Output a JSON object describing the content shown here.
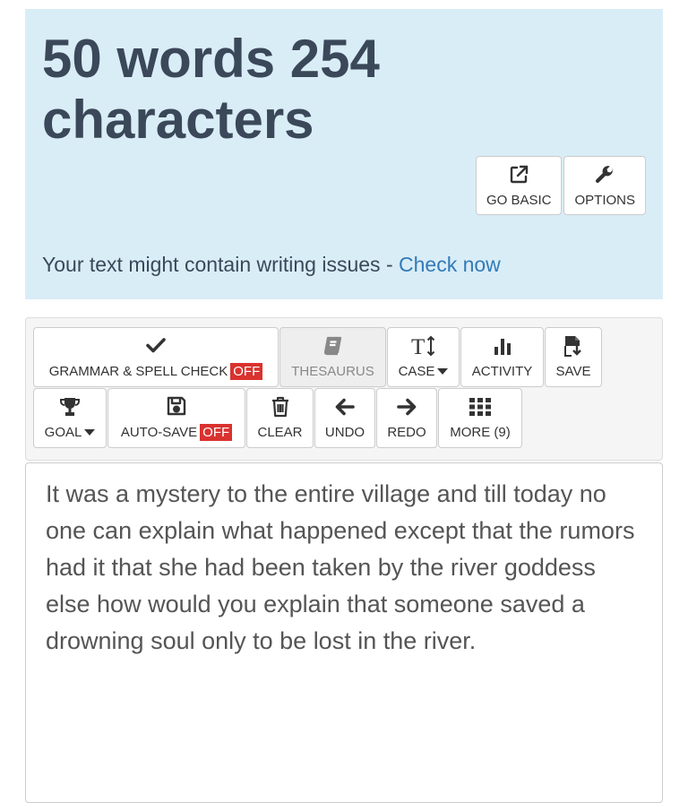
{
  "stats": {
    "title": "50 words 254 characters"
  },
  "top_buttons": {
    "go_basic": "GO BASIC",
    "options": "OPTIONS"
  },
  "issues": {
    "text": "Your text might contain writing issues - ",
    "link": "Check now"
  },
  "toolbar": {
    "grammar": "GRAMMAR & SPELL CHECK",
    "grammar_state": "OFF",
    "thesaurus": "THESAURUS",
    "case": "CASE",
    "activity": "ACTIVITY",
    "save": "SAVE",
    "goal": "GOAL",
    "autosave": "AUTO-SAVE",
    "autosave_state": "OFF",
    "clear": "CLEAR",
    "undo": "UNDO",
    "redo": "REDO",
    "more": "MORE (9)"
  },
  "editor": {
    "text": "It was a mystery to the entire village and till today no one can explain what happened except that the rumors had it that she had been taken by the river goddess else how would you explain that someone saved a drowning soul only to be lost in the river."
  },
  "colors": {
    "panel_bg": "#d9edf7",
    "title": "#3b4859",
    "link": "#337ab7",
    "off_badge": "#d9322f"
  },
  "icons": {
    "go_basic": "external-link-icon",
    "options": "wrench-icon",
    "grammar": "checkmark-icon",
    "thesaurus": "book-icon",
    "case": "text-height-icon",
    "activity": "bar-chart-icon",
    "save": "file-download-icon",
    "goal": "trophy-icon",
    "autosave": "floppy-disk-icon",
    "clear": "trash-icon",
    "undo": "arrow-left-icon",
    "redo": "arrow-right-icon",
    "more": "grid-icon"
  }
}
